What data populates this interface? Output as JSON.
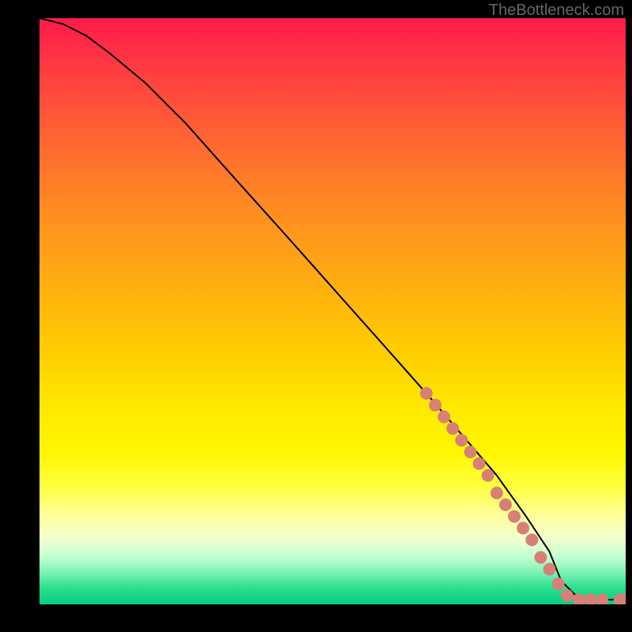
{
  "attribution": "TheBottleneck.com",
  "chart_data": {
    "type": "line",
    "title": "",
    "xlabel": "",
    "ylabel": "",
    "xlim": [
      0,
      100
    ],
    "ylim": [
      0,
      100
    ],
    "curve": {
      "name": "bottleneck-curve",
      "x": [
        0,
        4,
        8,
        12,
        18,
        25,
        33,
        42,
        50,
        58,
        66,
        72,
        78,
        83,
        87,
        89,
        92,
        96,
        100
      ],
      "y": [
        100,
        99,
        97,
        94,
        89,
        82,
        73,
        63,
        54,
        45,
        36,
        29,
        22,
        15,
        9,
        4,
        1,
        0.8,
        0.8
      ]
    },
    "markers": {
      "name": "highlight-segment",
      "color": "#d87f78",
      "points": [
        {
          "x": 66,
          "y": 36
        },
        {
          "x": 67.5,
          "y": 34
        },
        {
          "x": 69,
          "y": 32
        },
        {
          "x": 70.5,
          "y": 30
        },
        {
          "x": 72,
          "y": 28
        },
        {
          "x": 73.5,
          "y": 26
        },
        {
          "x": 75,
          "y": 24
        },
        {
          "x": 76.5,
          "y": 22
        },
        {
          "x": 78,
          "y": 19
        },
        {
          "x": 79.5,
          "y": 17
        },
        {
          "x": 81,
          "y": 15
        },
        {
          "x": 82.5,
          "y": 13
        },
        {
          "x": 84,
          "y": 11
        },
        {
          "x": 85.5,
          "y": 8
        },
        {
          "x": 87,
          "y": 6
        },
        {
          "x": 88.5,
          "y": 3.5
        },
        {
          "x": 90,
          "y": 1.5
        },
        {
          "x": 92,
          "y": 0.8
        },
        {
          "x": 94,
          "y": 0.8
        },
        {
          "x": 96,
          "y": 0.8
        },
        {
          "x": 99,
          "y": 0.8
        },
        {
          "x": 100,
          "y": 0.8
        }
      ]
    }
  }
}
